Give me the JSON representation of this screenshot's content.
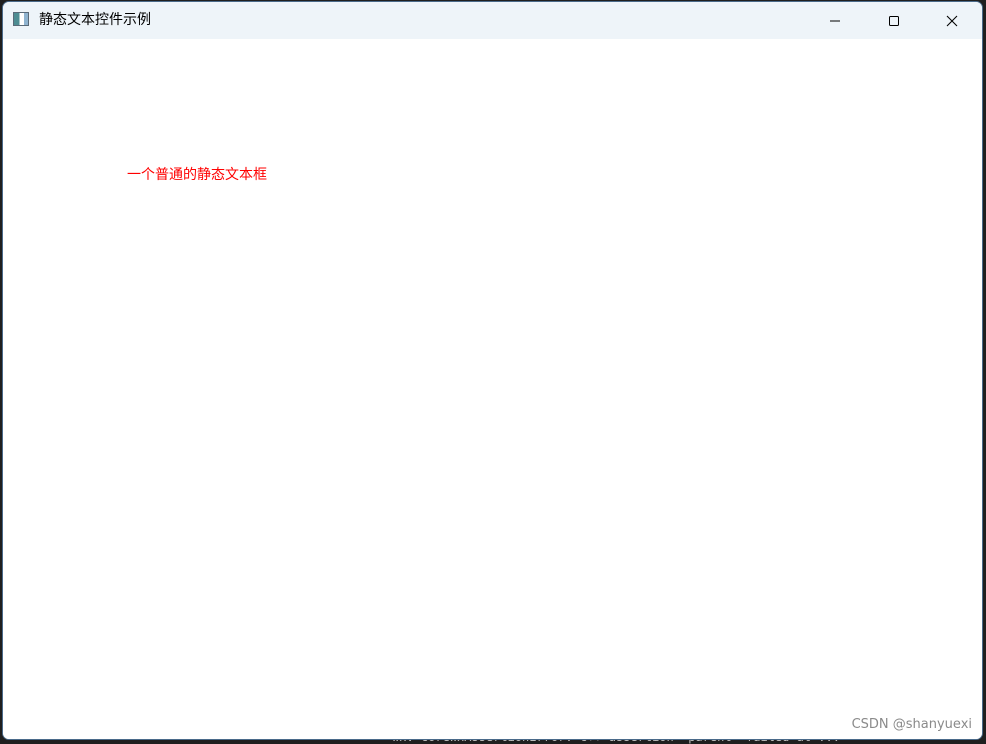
{
  "window": {
    "title": "静态文本控件示例",
    "icon": "app-window-icon",
    "controls": {
      "minimize_icon": "minimize-icon",
      "maximize_icon": "maximize-icon",
      "close_icon": "close-icon"
    }
  },
  "static_text": {
    "label": "一个普通的静态文本框",
    "color": "#ff0000"
  },
  "watermark": {
    "text": "CSDN @shanyuexi"
  },
  "background_console": {
    "text": "wxV coreWxAssertionError: C++ assertion \"parent\" failed at ..."
  },
  "colors": {
    "titlebar_bg": "#eef4f9",
    "client_bg": "#ffffff",
    "text_accent": "#ff0000"
  }
}
